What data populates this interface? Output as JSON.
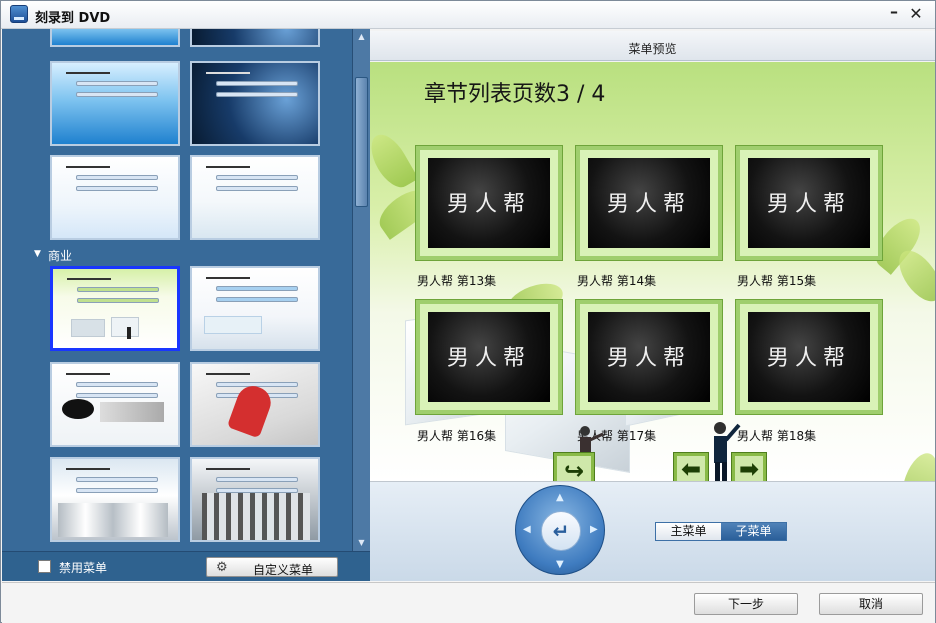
{
  "window": {
    "title": "刻录到 DVD",
    "minimize_label": "–",
    "close_label": "✕"
  },
  "left_panel": {
    "section_title": "商业",
    "bottom": {
      "disable_menu_label": "禁用菜单",
      "custom_menu_label": "自定义菜单"
    }
  },
  "preview": {
    "header_title": "菜单预览",
    "page_title": "章节列表页数3 / 4",
    "chapters": [
      {
        "label": "男人帮 第13集",
        "logo": "男人帮"
      },
      {
        "label": "男人帮 第14集",
        "logo": "男人帮"
      },
      {
        "label": "男人帮 第15集",
        "logo": "男人帮"
      },
      {
        "label": "男人帮 第16集",
        "logo": "男人帮"
      },
      {
        "label": "男人帮 第17集",
        "logo": "男人帮"
      },
      {
        "label": "男人帮 第18集",
        "logo": "男人帮"
      }
    ],
    "nav": {
      "return_icon": "return-arrow-icon",
      "prev_icon": "left-arrow-icon",
      "next_icon": "right-arrow-icon"
    }
  },
  "controls": {
    "enter_icon": "enter-icon",
    "main_menu_label": "主菜单",
    "sub_menu_label": "子菜单"
  },
  "footer": {
    "next_label": "下一步",
    "cancel_label": "取消"
  }
}
